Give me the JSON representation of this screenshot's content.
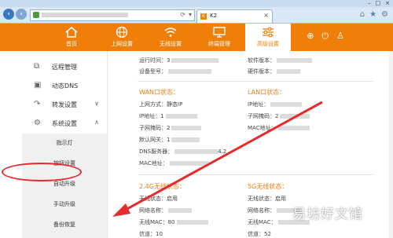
{
  "browser": {
    "tab_title": "K2",
    "tab_favicon": "K",
    "close_glyph": "×",
    "win_buttons": [
      "–",
      "□",
      "×"
    ]
  },
  "nav": {
    "items": [
      {
        "label": "首页",
        "icon": "home-icon"
      },
      {
        "label": "上网设置",
        "icon": "globe-icon"
      },
      {
        "label": "无线设置",
        "icon": "wifi-icon"
      },
      {
        "label": "终端管理",
        "icon": "monitor-icon"
      },
      {
        "label": "高级设置",
        "icon": "sliders-icon"
      }
    ],
    "active_index": 4,
    "colors": {
      "accent": "#f07f0a",
      "highlight": "#e52b2b"
    }
  },
  "sidebar": {
    "items": [
      {
        "label": "远程管理",
        "icon": "remote-icon"
      },
      {
        "label": "动态DNS",
        "icon": "dns-icon"
      },
      {
        "label": "转发设置",
        "icon": "forward-icon"
      },
      {
        "label": "系统设置",
        "icon": "gear-icon"
      }
    ],
    "submenu": [
      "指示灯",
      "按钮设置",
      "自动升级",
      "手动升级",
      "备份恢复"
    ]
  },
  "content": {
    "top": {
      "run_time_label": "运行时间：",
      "run_time_value": "3",
      "device_id_label": "设备型号：",
      "device_id_value": "",
      "soft_ver_label": "软件版本：",
      "soft_ver_value": "",
      "hard_ver_label": "硬件版本：",
      "hard_ver_value": ""
    },
    "wan": {
      "title": "WAN口状态：",
      "mode_label": "上网方式：",
      "mode_value": "静态IP",
      "ip_label": "IP地址：",
      "ip_value": "1",
      "mask_label": "子网掩码：",
      "mask_value": "2",
      "gw_label": "默认网关：",
      "gw_value": "1",
      "dns_label": "DNS服务器：",
      "dns_value": "4.2",
      "mac_label": "MAC地址："
    },
    "lan": {
      "title": "LAN口状态：",
      "ip_label": "IP地址：",
      "mask_label": "子网掩码：",
      "mask_value": "2",
      "mac_label": "MAC地址："
    },
    "wifi24": {
      "title": "2.4G无线状态：",
      "state_label": "无线状态：",
      "state_value": "启用",
      "ssid_label": "网络名称：",
      "mac_label": "无线MAC：",
      "mac_value": "80",
      "channel_label": "信道：",
      "channel_value": "10"
    },
    "wifi5": {
      "title": "5G无线状态：",
      "state_label": "无线状态：",
      "state_value": "启用",
      "ssid_label": "网络名称：",
      "mac_label": "无线MAC：",
      "channel_label": "信道：",
      "channel_value": "52"
    }
  },
  "watermark": "易坊好文馆"
}
